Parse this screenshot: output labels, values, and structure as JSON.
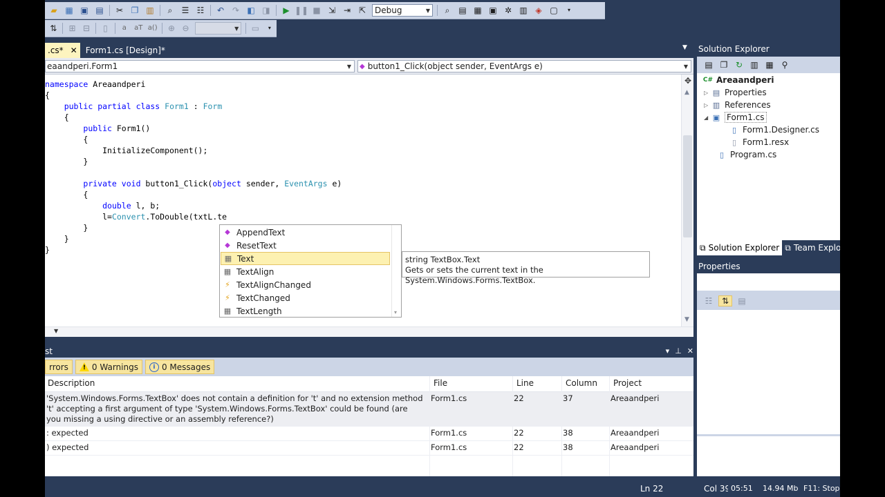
{
  "toolbar": {
    "config_value": "Debug",
    "find_value": ""
  },
  "doc_tabs": [
    {
      "label": ".cs*",
      "active": true
    },
    {
      "label": "Form1.cs [Design]*",
      "active": false
    }
  ],
  "nav": {
    "left": "eaandperi.Form1",
    "right": "button1_Click(object sender, EventArgs e)"
  },
  "code_lines": [
    [
      {
        "t": "namespace",
        "c": "kw"
      },
      {
        "t": " Areaandperi"
      }
    ],
    [
      {
        "t": "{"
      }
    ],
    [
      {
        "t": "    "
      },
      {
        "t": "public",
        "c": "kw"
      },
      {
        "t": " "
      },
      {
        "t": "partial",
        "c": "kw"
      },
      {
        "t": " "
      },
      {
        "t": "class",
        "c": "kw"
      },
      {
        "t": " "
      },
      {
        "t": "Form1",
        "c": "ty"
      },
      {
        "t": " : "
      },
      {
        "t": "Form",
        "c": "ty"
      }
    ],
    [
      {
        "t": "    {"
      }
    ],
    [
      {
        "t": "        "
      },
      {
        "t": "public",
        "c": "kw"
      },
      {
        "t": " Form1()"
      }
    ],
    [
      {
        "t": "        {"
      }
    ],
    [
      {
        "t": "            InitializeComponent();"
      }
    ],
    [
      {
        "t": "        }"
      }
    ],
    [
      {
        "t": ""
      }
    ],
    [
      {
        "t": "        "
      },
      {
        "t": "private",
        "c": "kw"
      },
      {
        "t": " "
      },
      {
        "t": "void",
        "c": "kw"
      },
      {
        "t": " button1_Click("
      },
      {
        "t": "object",
        "c": "kw"
      },
      {
        "t": " sender, "
      },
      {
        "t": "EventArgs",
        "c": "ty"
      },
      {
        "t": " e)"
      }
    ],
    [
      {
        "t": "        {"
      }
    ],
    [
      {
        "t": "            "
      },
      {
        "t": "double",
        "c": "kw"
      },
      {
        "t": " l, b;"
      }
    ],
    [
      {
        "t": "            l="
      },
      {
        "t": "Convert",
        "c": "ty"
      },
      {
        "t": ".ToDouble(txtL.te"
      }
    ],
    [
      {
        "t": "        }"
      }
    ],
    [
      {
        "t": "    }"
      }
    ],
    [
      {
        "t": "}"
      }
    ]
  ],
  "completion": {
    "items": [
      {
        "label": "AppendText",
        "kind": "method"
      },
      {
        "label": "ResetText",
        "kind": "method"
      },
      {
        "label": "Text",
        "kind": "property",
        "selected": true
      },
      {
        "label": "TextAlign",
        "kind": "property"
      },
      {
        "label": "TextAlignChanged",
        "kind": "event"
      },
      {
        "label": "TextChanged",
        "kind": "event"
      },
      {
        "label": "TextLength",
        "kind": "property"
      }
    ]
  },
  "tooltip": {
    "signature": "string TextBox.Text",
    "description": "Gets or sets the current text in the System.Windows.Forms.TextBox."
  },
  "error_list": {
    "title": "st",
    "errors_label": "rrors",
    "warnings_label": "0 Warnings",
    "messages_label": "0 Messages",
    "columns": {
      "description": "Description",
      "file": "File",
      "line": "Line",
      "column": "Column",
      "project": "Project"
    },
    "rows": [
      {
        "description": "'System.Windows.Forms.TextBox' does not contain a definition for 't' and no extension method 't' accepting a first argument of type 'System.Windows.Forms.TextBox' could be found (are you missing a using directive or an assembly reference?)",
        "file": "Form1.cs",
        "line": "22",
        "column": "37",
        "project": "Areaandperi"
      },
      {
        "description": ": expected",
        "file": "Form1.cs",
        "line": "22",
        "column": "38",
        "project": "Areaandperi"
      },
      {
        "description": ") expected",
        "file": "Form1.cs",
        "line": "22",
        "column": "38",
        "project": "Areaandperi"
      }
    ]
  },
  "solution_explorer": {
    "title": "Solution Explorer",
    "tree": [
      {
        "label": "Areaandperi",
        "bold": true,
        "expander": "",
        "icon": "csharp-project-icon"
      },
      {
        "label": "Properties",
        "expander": "▷",
        "icon": "properties-icon"
      },
      {
        "label": "References",
        "expander": "▷",
        "icon": "references-icon"
      },
      {
        "label": "Form1.cs",
        "expander": "◢",
        "icon": "form-icon",
        "selected": true
      },
      {
        "label": "Form1.Designer.cs",
        "expander": "",
        "icon": "cs-file-icon"
      },
      {
        "label": "Form1.resx",
        "expander": "",
        "icon": "resx-file-icon"
      },
      {
        "label": "Program.cs",
        "expander": "",
        "icon": "cs-file-icon"
      }
    ],
    "tabs": [
      "Solution Explorer",
      "Team Explor"
    ]
  },
  "properties": {
    "title": "Properties"
  },
  "status": {
    "ln": "Ln 22",
    "col": "Col 39",
    "time": "05:51",
    "memory": "14.94 Mb",
    "hint": "F11: Stop"
  }
}
